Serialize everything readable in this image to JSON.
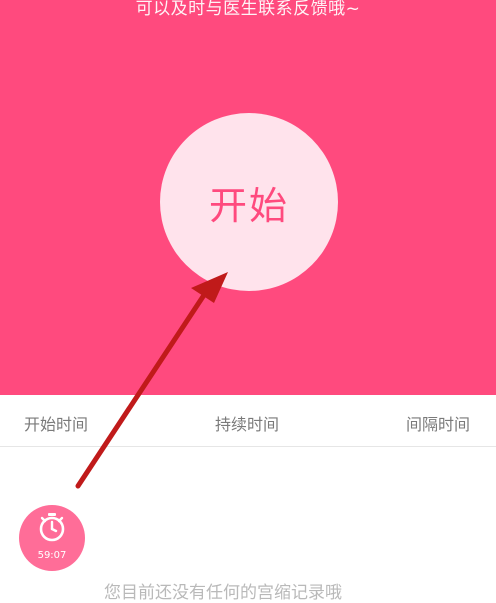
{
  "hero": {
    "tip": "可以及时与医生联系反馈哦~",
    "start_label": "开始"
  },
  "columns": {
    "start_time": "开始时间",
    "duration": "持续时间",
    "interval": "间隔时间"
  },
  "timer": {
    "time": "59:07",
    "icon": "stopwatch-icon"
  },
  "empty_state": {
    "message": "您目前还没有任何的宫缩记录哦"
  },
  "colors": {
    "primary": "#ff4a7e",
    "circle": "#ffe3ec",
    "fab": "#ff6d98",
    "annotation_arrow": "#c01a1a"
  }
}
